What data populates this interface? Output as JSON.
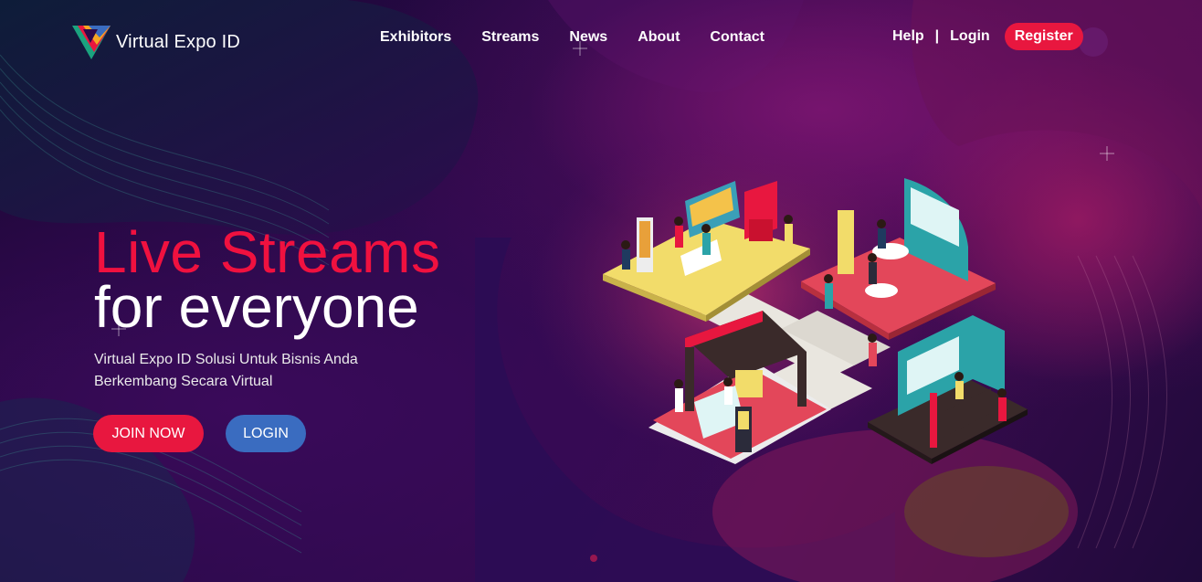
{
  "brand": {
    "name": "Virtual Expo ID"
  },
  "nav": {
    "items": [
      {
        "label": "Exhibitors"
      },
      {
        "label": "Streams"
      },
      {
        "label": "News"
      },
      {
        "label": "About"
      },
      {
        "label": "Contact"
      }
    ],
    "help_label": "Help",
    "separator": "|",
    "login_label": "Login",
    "register_label": "Register"
  },
  "hero": {
    "title_line1": "Live Streams",
    "title_line2": "for everyone",
    "subtitle": "Virtual Expo ID Solusi Untuk Bisnis Anda Berkembang Secara Virtual",
    "join_label": "JOIN NOW",
    "login_label": "LOGIN"
  },
  "colors": {
    "accent": "#e8173f",
    "secondary": "#3a6cc0",
    "background": "#2a0a4a"
  },
  "icons": {
    "logo": "v-triangle-logo-icon",
    "illustration": "isometric-expo-booths-illustration"
  }
}
